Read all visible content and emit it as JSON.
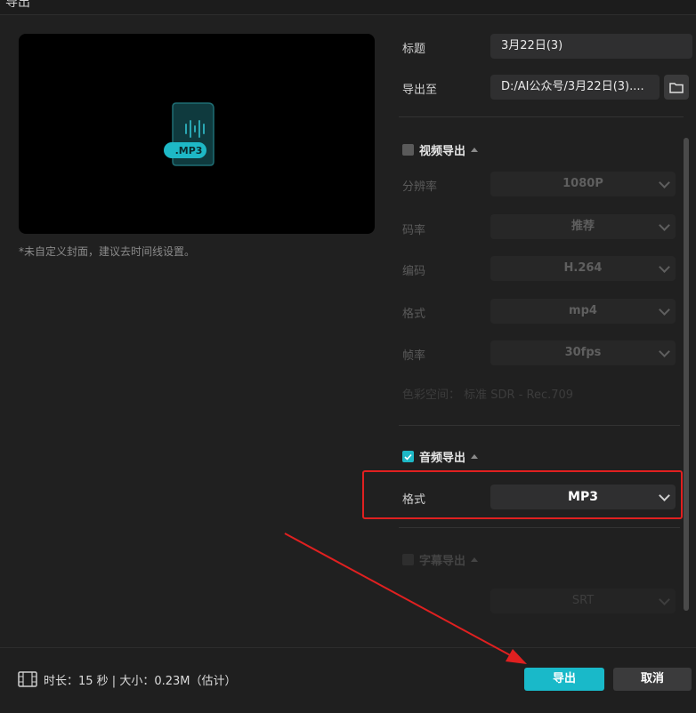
{
  "window": {
    "title": "导出"
  },
  "preview": {
    "badge": ".MP3",
    "note": "*未自定义封面，建议去时间线设置。"
  },
  "fields": {
    "title_label": "标题",
    "title_value": "3月22日(3)",
    "export_to_label": "导出至",
    "export_to_value": "D:/AI公众号/3月22日(3)...."
  },
  "video_export": {
    "label": "视频导出",
    "checked": false,
    "rows": [
      {
        "label": "分辨率",
        "value": "1080P"
      },
      {
        "label": "码率",
        "value": "推荐"
      },
      {
        "label": "编码",
        "value": "H.264"
      },
      {
        "label": "格式",
        "value": "mp4"
      },
      {
        "label": "帧率",
        "value": "30fps"
      }
    ],
    "color_space": "色彩空间：  标准 SDR - Rec.709"
  },
  "audio_export": {
    "label": "音频导出",
    "checked": true,
    "format_label": "格式",
    "format_value": "MP3"
  },
  "subtitle_export": {
    "label": "字幕导出",
    "checked": false,
    "format_value": "SRT"
  },
  "footer": {
    "info": "时长：15 秒 | 大小：0.23M（估计）",
    "export_button": "导出",
    "cancel_button": "取消"
  },
  "colors": {
    "accent": "#19b9c9",
    "annotation": "#e02020"
  },
  "icons": [
    "audio-file-icon",
    "folder-icon",
    "film-icon",
    "chevron-down-icon",
    "checkmark-icon"
  ]
}
